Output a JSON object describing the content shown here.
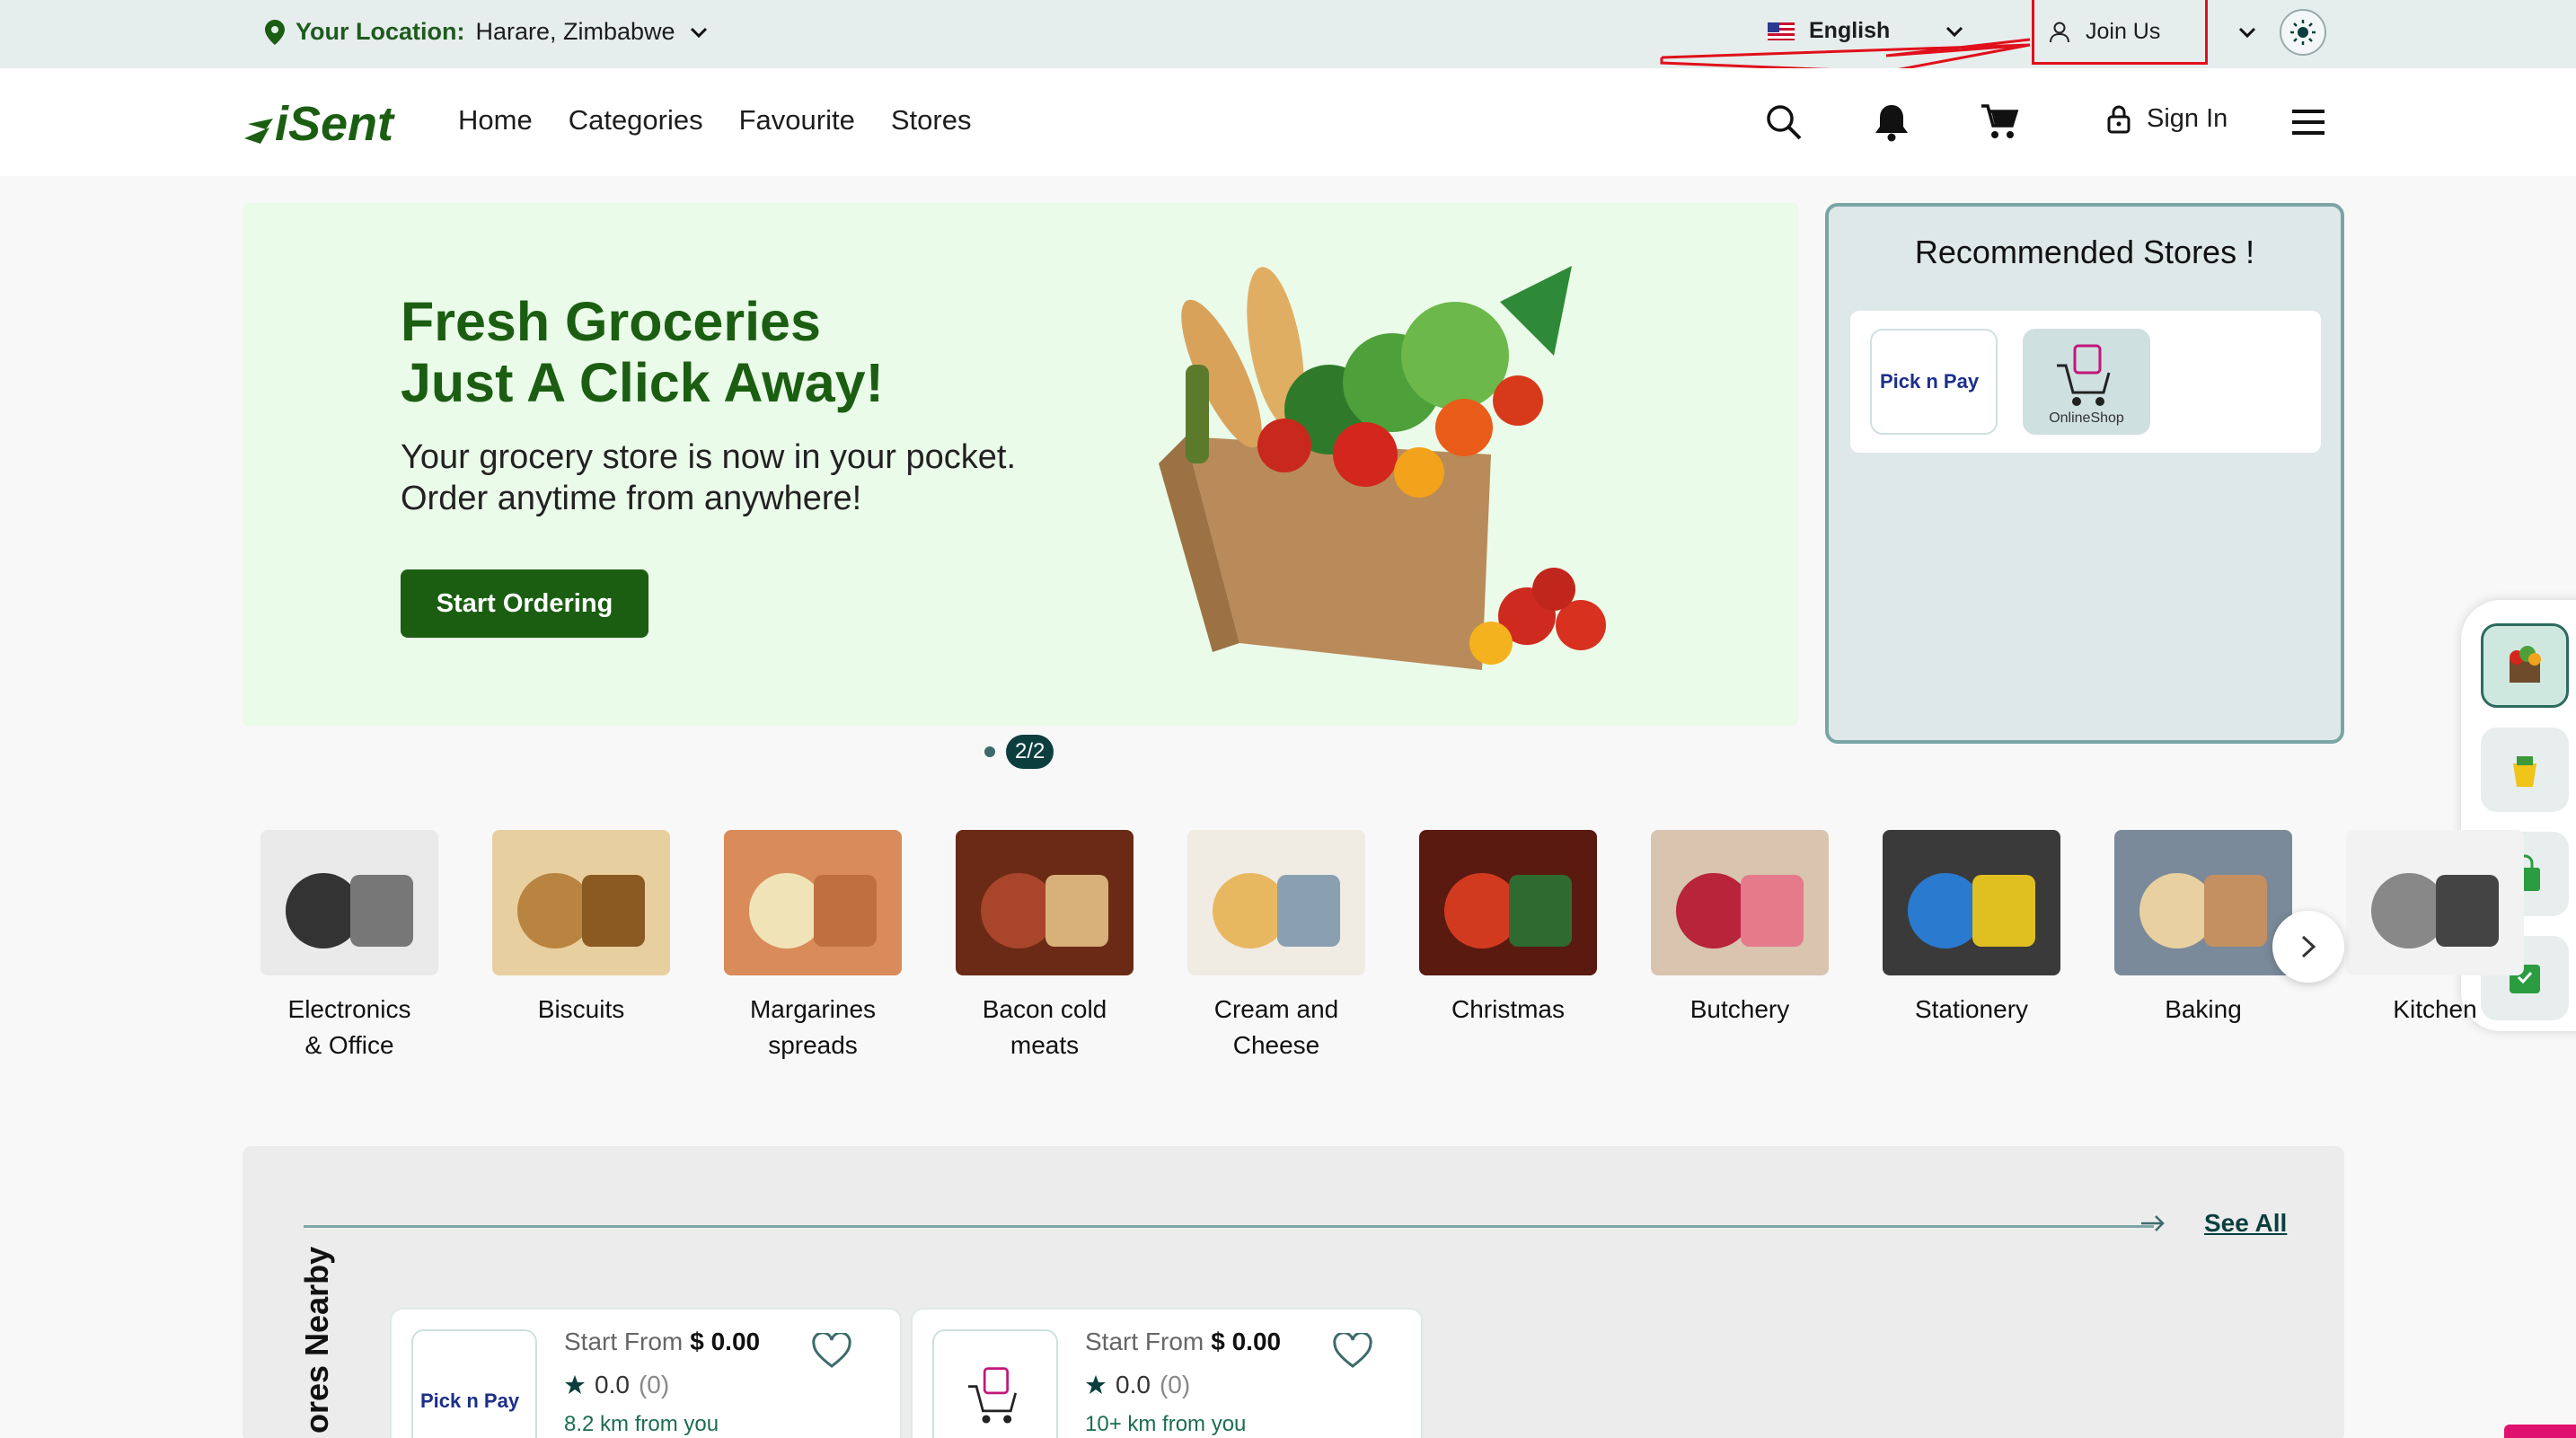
{
  "topbar": {
    "location_label": "Your Location:",
    "location_value": "Harare, Zimbabwe",
    "language": "English",
    "join": "Join Us"
  },
  "header": {
    "logo_text": "iSent",
    "nav": [
      "Home",
      "Categories",
      "Favourite",
      "Stores"
    ],
    "sign_in": "Sign In"
  },
  "hero": {
    "title_line1": "Fresh Groceries",
    "title_line2": "Just A Click Away!",
    "subtitle": "Your grocery store is now in your pocket. Order anytime from anywhere!",
    "cta": "Start Ordering",
    "slide_indicator": "2/2"
  },
  "recommended": {
    "title": "Recommended Stores !",
    "stores": [
      "Pick n Pay",
      "OnlineShop"
    ]
  },
  "categories": [
    {
      "name": "Electronics & Office"
    },
    {
      "name": "Biscuits"
    },
    {
      "name": "Margarines spreads"
    },
    {
      "name": "Bacon cold meats"
    },
    {
      "name": "Cream and Cheese"
    },
    {
      "name": "Christmas"
    },
    {
      "name": "Butchery"
    },
    {
      "name": "Stationery"
    },
    {
      "name": "Baking"
    },
    {
      "name": "Kitchen"
    }
  ],
  "nearby": {
    "title": "ores Nearby",
    "see_all": "See All",
    "stores": [
      {
        "start_from_label": "Start From",
        "price": "$ 0.00",
        "rating": "0.0",
        "count": "(0)",
        "distance": "8.2 km  from you"
      },
      {
        "start_from_label": "Start From",
        "price": "$ 0.00",
        "rating": "0.0",
        "count": "(0)",
        "distance": "10+ km  from you"
      }
    ]
  },
  "colors": {
    "brand_green": "#1b5e12",
    "accent_teal": "#0c3e3e",
    "annotation_red": "#e0101a"
  }
}
